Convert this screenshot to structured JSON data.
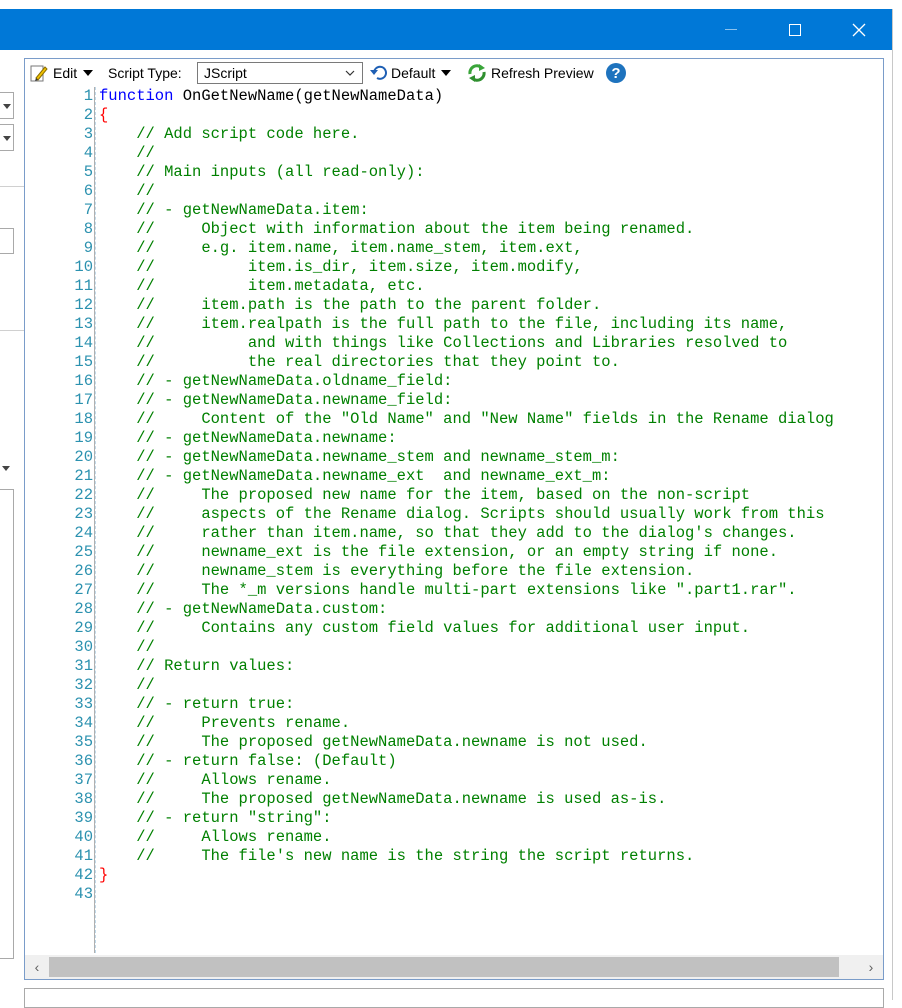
{
  "window": {
    "minimize_label": "",
    "maximize_label": "",
    "close_label": "✕"
  },
  "toolbar": {
    "edit_label": "Edit",
    "script_type_label": "Script Type:",
    "script_type_value": "JScript",
    "default_label": "Default",
    "refresh_label": "Refresh Preview",
    "help_label": "?"
  },
  "code": {
    "lines": [
      {
        "n": "1",
        "kw": "function",
        "text": " OnGetNewName(getNewNameData)"
      },
      {
        "n": "2",
        "brace": "{"
      },
      {
        "n": "3",
        "text": "    // Add script code here."
      },
      {
        "n": "4",
        "text": "    //"
      },
      {
        "n": "5",
        "text": "    // Main inputs (all read-only):"
      },
      {
        "n": "6",
        "text": "    //"
      },
      {
        "n": "7",
        "text": "    // - getNewNameData.item:"
      },
      {
        "n": "8",
        "text": "    //     Object with information about the item being renamed."
      },
      {
        "n": "9",
        "text": "    //     e.g. item.name, item.name_stem, item.ext,"
      },
      {
        "n": "10",
        "text": "    //          item.is_dir, item.size, item.modify,"
      },
      {
        "n": "11",
        "text": "    //          item.metadata, etc."
      },
      {
        "n": "12",
        "text": "    //     item.path is the path to the parent folder."
      },
      {
        "n": "13",
        "text": "    //     item.realpath is the full path to the file, including its name,"
      },
      {
        "n": "14",
        "text": "    //          and with things like Collections and Libraries resolved to"
      },
      {
        "n": "15",
        "text": "    //          the real directories that they point to."
      },
      {
        "n": "16",
        "text": "    // - getNewNameData.oldname_field:"
      },
      {
        "n": "17",
        "text": "    // - getNewNameData.newname_field:"
      },
      {
        "n": "18",
        "text": "    //     Content of the \"Old Name\" and \"New Name\" fields in the Rename dialog"
      },
      {
        "n": "19",
        "text": "    // - getNewNameData.newname:"
      },
      {
        "n": "20",
        "text": "    // - getNewNameData.newname_stem and newname_stem_m:"
      },
      {
        "n": "21",
        "text": "    // - getNewNameData.newname_ext  and newname_ext_m:"
      },
      {
        "n": "22",
        "text": "    //     The proposed new name for the item, based on the non-script"
      },
      {
        "n": "23",
        "text": "    //     aspects of the Rename dialog. Scripts should usually work from this"
      },
      {
        "n": "24",
        "text": "    //     rather than item.name, so that they add to the dialog's changes."
      },
      {
        "n": "25",
        "text": "    //     newname_ext is the file extension, or an empty string if none."
      },
      {
        "n": "26",
        "text": "    //     newname_stem is everything before the file extension."
      },
      {
        "n": "27",
        "text": "    //     The *_m versions handle multi-part extensions like \".part1.rar\"."
      },
      {
        "n": "28",
        "text": "    // - getNewNameData.custom:"
      },
      {
        "n": "29",
        "text": "    //     Contains any custom field values for additional user input."
      },
      {
        "n": "30",
        "text": "    //"
      },
      {
        "n": "31",
        "text": "    // Return values:"
      },
      {
        "n": "32",
        "text": "    //"
      },
      {
        "n": "33",
        "text": "    // - return true:"
      },
      {
        "n": "34",
        "text": "    //     Prevents rename."
      },
      {
        "n": "35",
        "text": "    //     The proposed getNewNameData.newname is not used."
      },
      {
        "n": "36",
        "text": "    // - return false: (Default)"
      },
      {
        "n": "37",
        "text": "    //     Allows rename."
      },
      {
        "n": "38",
        "text": "    //     The proposed getNewNameData.newname is used as-is."
      },
      {
        "n": "39",
        "text": "    // - return \"string\":"
      },
      {
        "n": "40",
        "text": "    //     Allows rename."
      },
      {
        "n": "41",
        "text": "    //     The file's new name is the string the script returns."
      },
      {
        "n": "42",
        "brace": "}"
      },
      {
        "n": "43",
        "text": ""
      }
    ]
  },
  "scrollbar": {
    "left_arrow": "‹",
    "right_arrow": "›"
  },
  "colors": {
    "titlebar": "#0078d7",
    "comment": "#008000",
    "keyword": "#0000ff",
    "line_number": "#2b91af",
    "brace": "#ff0000"
  }
}
